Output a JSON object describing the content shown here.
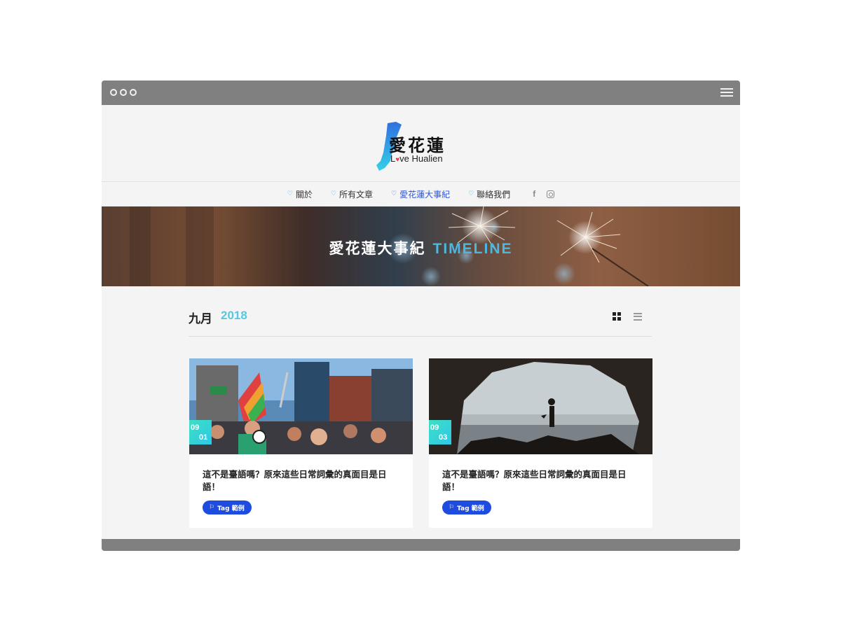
{
  "site": {
    "logo_title": "愛花蓮",
    "logo_sub_before": "L",
    "logo_sub_heart": "♥",
    "logo_sub_after": "ve Hualien"
  },
  "nav": {
    "items": [
      {
        "label": "關於",
        "active": false
      },
      {
        "label": "所有文章",
        "active": false
      },
      {
        "label": "愛花蓮大事紀",
        "active": true
      },
      {
        "label": "聯絡我們",
        "active": false
      }
    ],
    "heart_glyph": "♡",
    "facebook_glyph": "f"
  },
  "hero": {
    "title": "愛花蓮大事紀",
    "accent": "TIMELINE"
  },
  "archive": {
    "month": "九月",
    "year": "2018"
  },
  "posts": [
    {
      "date_month": "09",
      "date_day": "01",
      "title": "這不是臺語嗎？原來這些日常詞彙的真面目是日語！",
      "tag": "Tag 範例"
    },
    {
      "date_month": "09",
      "date_day": "03",
      "title": "這不是臺語嗎？原來這些日常詞彙的真面目是日語！",
      "tag": "Tag 範例"
    }
  ],
  "colors": {
    "accent_blue": "#2d55d8",
    "light_blue": "#54c8e0",
    "tag_blue": "#1e4be0",
    "chrome_gray": "#808080"
  }
}
